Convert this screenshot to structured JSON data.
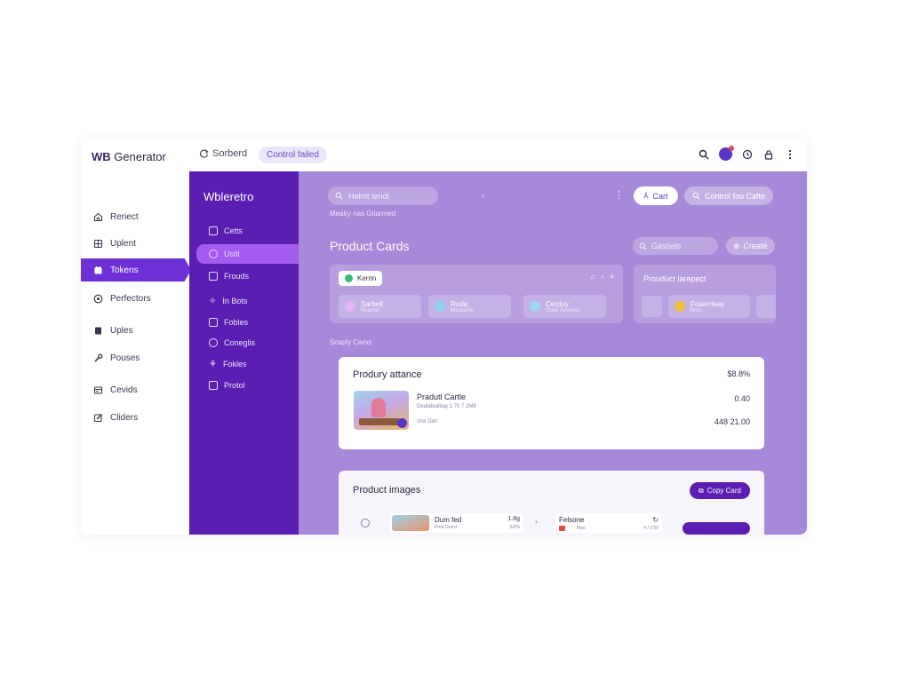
{
  "brand": {
    "bold": "WB",
    "rest": " Generator"
  },
  "topbar": {
    "refresh_label": "Sorberd",
    "pill_label": "Control failed",
    "icons": [
      "search-icon",
      "avatar-icon",
      "clock-icon",
      "lock-icon",
      "more-vertical-icon"
    ]
  },
  "leftnav": {
    "items": [
      {
        "label": "Reriect",
        "icon": "home-icon"
      },
      {
        "label": "Uplent",
        "icon": "grid-icon"
      },
      {
        "label": "Tokens",
        "icon": "tokens-icon",
        "active": true
      },
      {
        "label": "Perfectors",
        "icon": "gauge-icon"
      },
      {
        "label": "Uples",
        "icon": "document-icon"
      },
      {
        "label": "Pouses",
        "icon": "wrench-icon"
      },
      {
        "label": "Cevids",
        "icon": "cards-icon"
      },
      {
        "label": "Cliders",
        "icon": "edit-icon"
      }
    ]
  },
  "sidebar": {
    "title": "Wbleretro",
    "items": [
      {
        "label": "Cetts",
        "icon": "image-icon"
      },
      {
        "label": "Ustil",
        "icon": "users-icon",
        "active": true
      },
      {
        "label": "Frouds",
        "icon": "frame-icon"
      },
      {
        "label": "In Bots",
        "icon": "sparkle-icon"
      },
      {
        "label": "Fobles",
        "icon": "table-icon"
      },
      {
        "label": "Coneglis",
        "icon": "circle-icon"
      },
      {
        "label": "Fokles",
        "icon": "puzzle-icon"
      },
      {
        "label": "Protol",
        "icon": "chat-icon"
      }
    ]
  },
  "main": {
    "search_placeholder": "Helmt tendt",
    "search_hint": "Mealry nas Gitarmed",
    "cart_label": "Cart",
    "control_label": "Control fou Cafte",
    "heading": "Product Cards",
    "filter_placeholder": "Gastielo",
    "create_label": "Create",
    "panel": {
      "chip_label": "Kerrin",
      "chip_color": "#3cb878",
      "minis": [
        {
          "title": "Sarbell",
          "sub": "Repeter",
          "color": "#e6b3f2"
        },
        {
          "title": "Roda",
          "sub": "Bleasetivl",
          "color": "#8fd3f0"
        },
        {
          "title": "Cerdoy",
          "sub": "Goce Sevuves",
          "color": "#9fd8f0"
        }
      ]
    },
    "side_panel": {
      "title": "Prouduct larepect",
      "mini": {
        "title": "Fouerrteay",
        "sub": "Broc",
        "color": "#f0c040"
      }
    },
    "section_label": "Scaply Cams",
    "card1": {
      "title": "Produry attance",
      "price": "$8.8%",
      "item_name": "Pradutl Cartle",
      "item_sub": "Dealatealbay 1 70 7 2M8",
      "item_view": "Vlor Dert",
      "value1": "0.40",
      "value2": "448 21.00"
    },
    "card2": {
      "title": "Product images",
      "copy_label": "Copy Card",
      "item_name": "Dum fed",
      "item_sub": "Prod Grard",
      "item_num": "1.8g",
      "item_num2": "5/2%",
      "rel_title": "Felsone",
      "rel_sub": "Mas",
      "rel_num": "4 / 2,50"
    }
  },
  "colors": {
    "accent": "#5a1fb2",
    "active_nav": "#6d2fd6",
    "main_bg": "#a689d8"
  }
}
